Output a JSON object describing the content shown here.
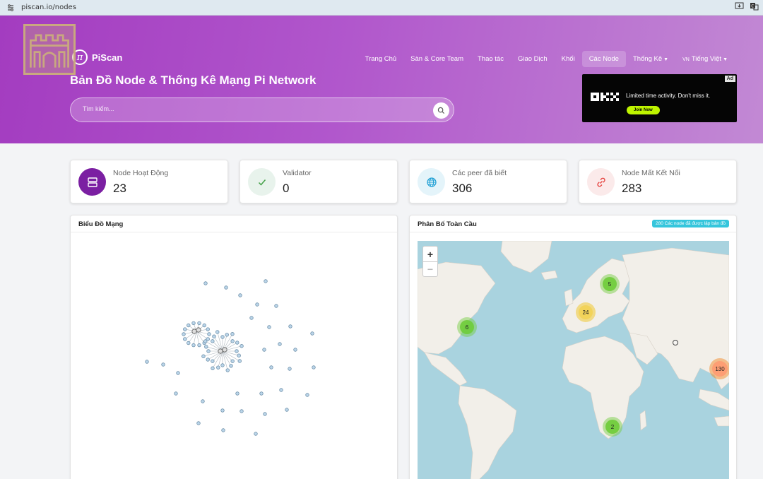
{
  "browser": {
    "url": "piscan.io/nodes"
  },
  "brand": {
    "name": "PiScan",
    "logo_glyph": "π"
  },
  "nav": {
    "items": [
      {
        "label": "Trang Chủ"
      },
      {
        "label": "Sàn & Core Team"
      },
      {
        "label": "Thao tác"
      },
      {
        "label": "Giao Dịch"
      },
      {
        "label": "Khối"
      },
      {
        "label": "Các Node",
        "active": true
      },
      {
        "label": "Thống Kê",
        "dropdown": true
      }
    ],
    "language": {
      "flag": "VN",
      "label": "Tiếng Việt"
    }
  },
  "hero": {
    "title": "Bản Đồ Node & Thống Kê Mạng Pi Network",
    "search_placeholder": "Tìm kiếm..."
  },
  "ad": {
    "tag": "Ad",
    "brand": "OKX",
    "text": "Limited time activity. Don't miss it.",
    "cta": "Join Now"
  },
  "stats": [
    {
      "label": "Node Hoạt Động",
      "value": "23",
      "icon": "server-icon",
      "color": "#8e24aa"
    },
    {
      "label": "Validator",
      "value": "0",
      "icon": "check-icon",
      "color": "#43a047"
    },
    {
      "label": "Các peer đã biết",
      "value": "306",
      "icon": "globe-icon",
      "color": "#1e9fd4"
    },
    {
      "label": "Node Mất Kết Nối",
      "value": "283",
      "icon": "link-broken-icon",
      "color": "#e53935"
    }
  ],
  "network_panel": {
    "title": "Biểu Đồ Mạng"
  },
  "map_panel": {
    "title": "Phân Bố Toàn Cầu",
    "badge": "280 Các node đã được lập bản đồ",
    "clusters": [
      {
        "count": "5",
        "color": "green",
        "region": "Scandinavia"
      },
      {
        "count": "24",
        "color": "yellow",
        "region": "Europe"
      },
      {
        "count": "6",
        "color": "green",
        "region": "North America East"
      },
      {
        "count": "130",
        "color": "orange",
        "region": "Southeast Asia"
      },
      {
        "count": "2",
        "color": "green",
        "region": "South Africa"
      }
    ]
  },
  "colors": {
    "hero_start": "#a33cc0",
    "hero_end": "#c289d4",
    "accent": "#8e24aa",
    "badge": "#36c6dc"
  }
}
